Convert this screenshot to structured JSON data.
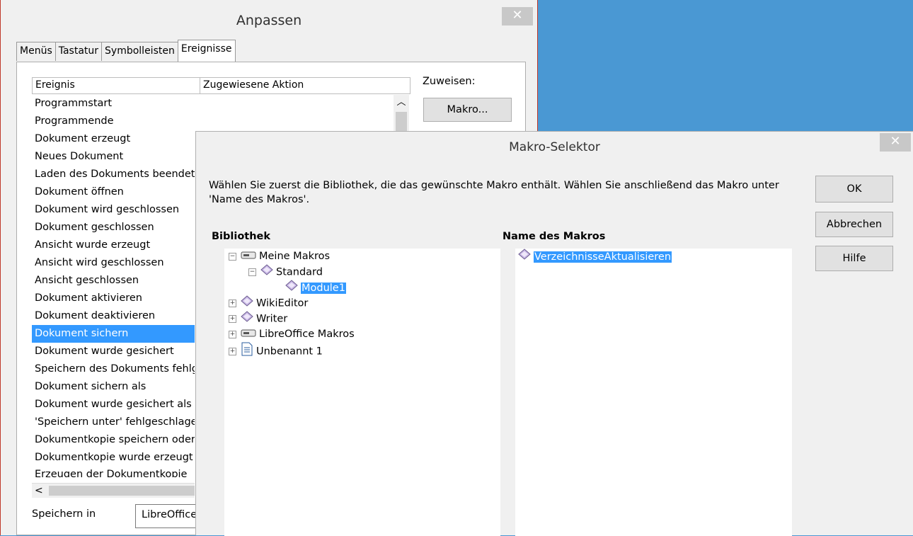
{
  "customize_dialog": {
    "title": "Anpassen",
    "close": "✕",
    "tabs": [
      "Menüs",
      "Tastatur",
      "Symbolleisten",
      "Ereignisse"
    ],
    "active_tab": "Ereignisse",
    "columns": [
      "Ereignis",
      "Zugewiesene Aktion"
    ],
    "events": [
      "Programmstart",
      "Programmende",
      "Dokument erzeugt",
      "Neues Dokument",
      "Laden des Dokuments beendet",
      "Dokument öffnen",
      "Dokument wird geschlossen",
      "Dokument geschlossen",
      "Ansicht wurde erzeugt",
      "Ansicht wird geschlossen",
      "Ansicht geschlossen",
      "Dokument aktivieren",
      "Dokument deaktivieren",
      "Dokument sichern",
      "Dokument wurde gesichert",
      "Speichern des Dokuments fehlgeschlagen",
      "Dokument sichern als",
      "Dokument wurde gesichert als",
      "'Speichern unter' fehlgeschlagen",
      "Dokumentkopie speichern oder exportieren",
      "Dokumentkopie wurde erzeugt",
      "Erzeugen der Dokumentkopie"
    ],
    "selected_event": "Dokument sichern",
    "assign_label": "Zuweisen:",
    "macro_button": "Makro...",
    "save_in_label": "Speichern in",
    "save_in_value": "LibreOffice"
  },
  "macro_selector": {
    "title": "Makro-Selektor",
    "close": "✕",
    "description": "Wählen Sie zuerst die Bibliothek, die das gewünschte Makro enthält. Wählen Sie anschließend das Makro unter 'Name des Makros'.",
    "library_label": "Bibliothek",
    "macro_name_label": "Name des Makros",
    "tree": {
      "my_macros": "Meine Makros",
      "standard": "Standard",
      "module1": "Module1",
      "wikieditor": "WikiEditor",
      "writer": "Writer",
      "libreoffice_macros": "LibreOffice Makros",
      "untitled": "Unbenannt 1"
    },
    "macros": [
      "VerzeichnisseAktualisieren"
    ],
    "buttons": {
      "ok": "OK",
      "cancel": "Abbrechen",
      "help": "Hilfe"
    }
  }
}
